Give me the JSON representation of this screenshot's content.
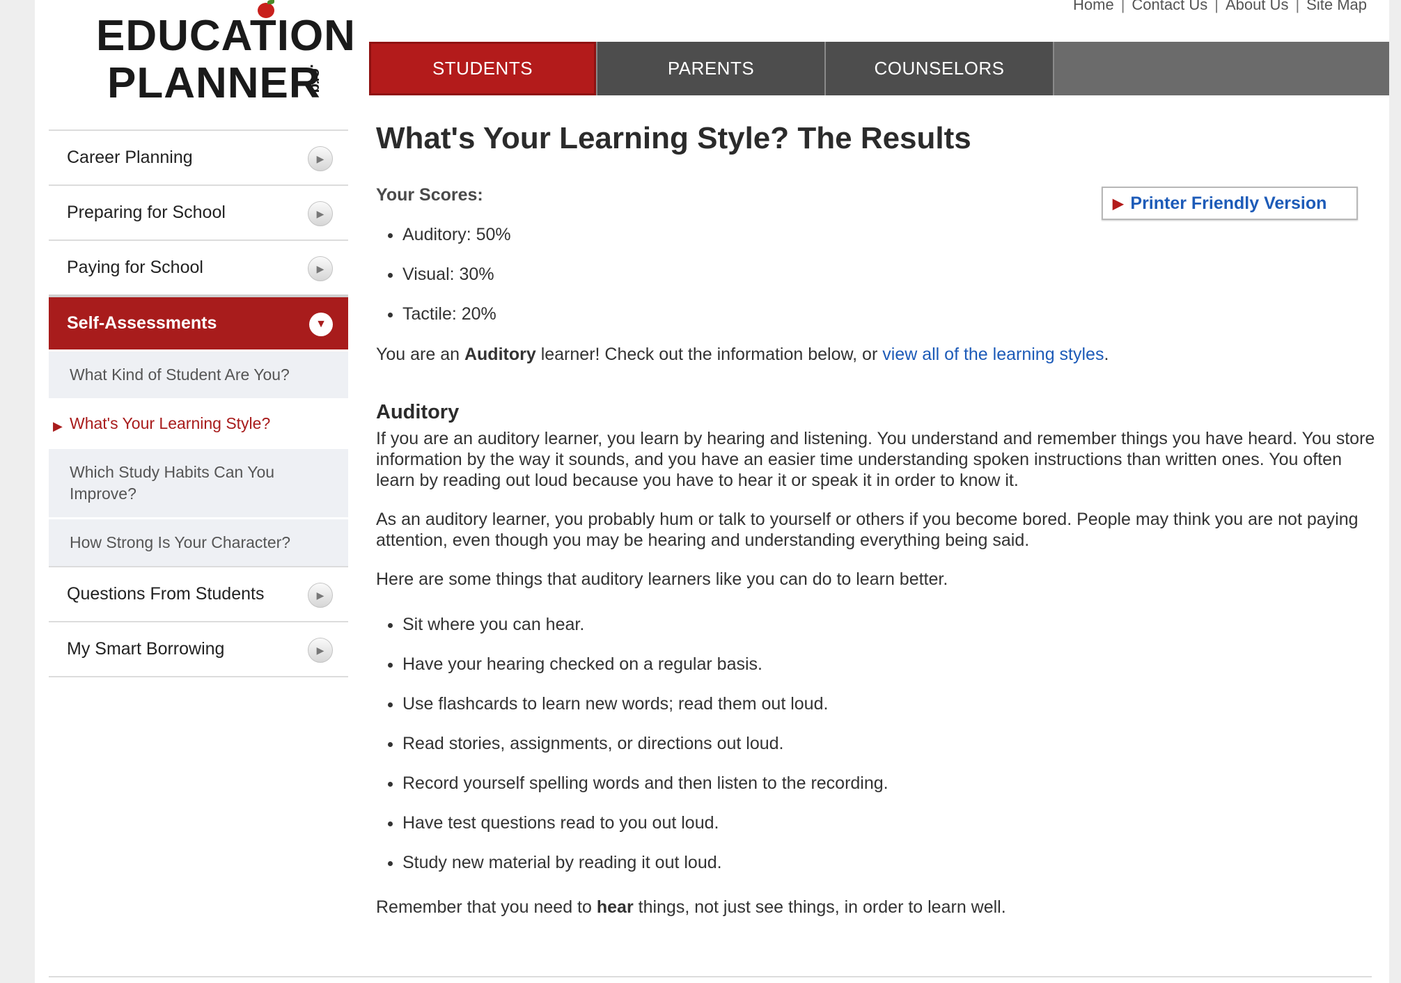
{
  "logo": {
    "line1": "EDUCATION",
    "line2": "PLANNER",
    "suffix": ".org",
    "sm": "SM"
  },
  "toplinks": [
    "Home",
    "Contact Us",
    "About Us",
    "Site Map"
  ],
  "nav": {
    "tabs": [
      "STUDENTS",
      "PARENTS",
      "COUNSELORS"
    ],
    "active": "STUDENTS"
  },
  "sidebar": {
    "items": [
      {
        "label": "Career Planning"
      },
      {
        "label": "Preparing for School"
      },
      {
        "label": "Paying for School"
      },
      {
        "label": "Self-Assessments"
      }
    ],
    "subitems": [
      "What Kind of Student Are You?",
      "What's Your Learning Style?",
      "Which Study Habits Can You Improve?",
      "How Strong Is Your Character?"
    ],
    "bottom_items": [
      {
        "label": "Questions From Students"
      },
      {
        "label": "My Smart Borrowing"
      }
    ]
  },
  "main": {
    "title": "What's Your Learning Style? The Results",
    "scores_label": "Your Scores:",
    "printer_friendly": "Printer Friendly Version",
    "scores": [
      "Auditory: 50%",
      "Visual: 30%",
      "Tactile: 20%"
    ],
    "summary": {
      "pre": "You are an ",
      "bold": "Auditory",
      "mid": " learner! Check out the information below, or ",
      "link": "view all of the learning styles",
      "post": "."
    },
    "section_title": "Auditory",
    "p1": "If you are an auditory learner, you learn by hearing and listening. You understand and remember things you have heard. You store information by the way it sounds, and you have an easier time understanding spoken instructions than written ones. You often learn by reading out loud because you have to hear it or speak it in order to know it.",
    "p2": "As an auditory learner, you probably hum or talk to yourself or others if you become bored. People may think you are not paying attention, even though you may be hearing and understanding everything being said.",
    "p3": "Here are some things that auditory learners like you can do to learn better.",
    "tips": [
      "Sit where you can hear.",
      "Have your hearing checked on a regular basis.",
      "Use flashcards to learn new words; read them out loud.",
      "Read stories, assignments, or directions out loud.",
      "Record yourself spelling words and then listen to the recording.",
      "Have test questions read to you out loud.",
      "Study new material by reading it out loud."
    ],
    "final": {
      "pre": "Remember that you need to ",
      "bold": "hear",
      "post": " things, not just see things, in order to learn well."
    }
  },
  "colors": {
    "accent_red": "#b31b1b",
    "link_blue": "#1d5bb8",
    "nav_dark": "#4d4d4d"
  }
}
